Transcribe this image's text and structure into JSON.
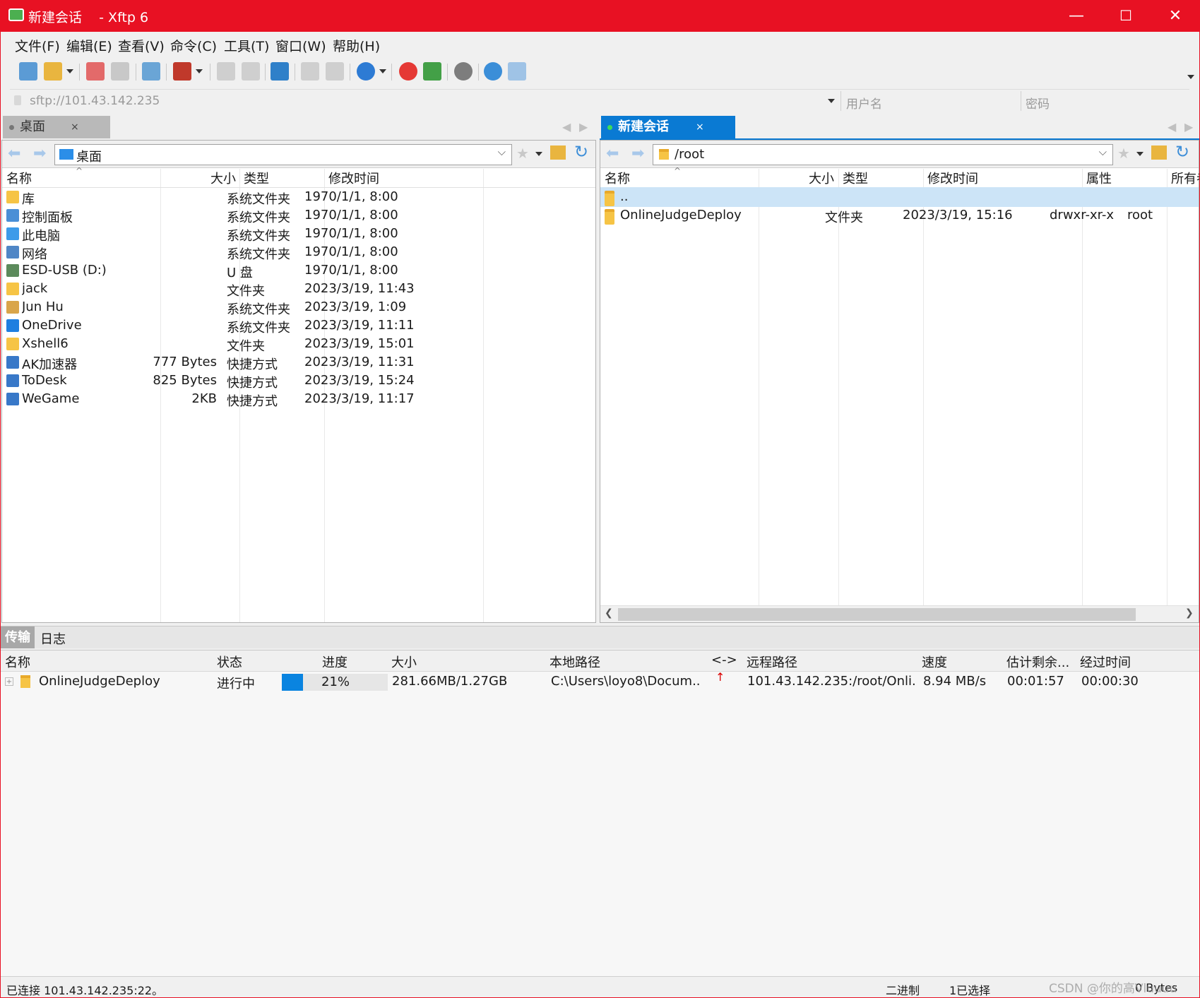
{
  "window": {
    "title": "新建会话    - Xftp 6",
    "controls": {
      "minimize": "—",
      "maximize": "☐",
      "close": "✕"
    }
  },
  "menu": [
    "文件(F)",
    "编辑(E)",
    "查看(V)",
    "命令(C)",
    "工具(T)",
    "窗口(W)",
    "帮助(H)"
  ],
  "address": {
    "url": "sftp://101.43.142.235",
    "username_placeholder": "用户名",
    "password_placeholder": "密码"
  },
  "local": {
    "tab_label": "桌面",
    "path": "桌面",
    "columns": [
      "名称",
      "大小",
      "类型",
      "修改时间"
    ],
    "rows": [
      {
        "name": "库",
        "size": "",
        "type": "系统文件夹",
        "modified": "1970/1/1, 8:00",
        "icon": "library-icon"
      },
      {
        "name": "控制面板",
        "size": "",
        "type": "系统文件夹",
        "modified": "1970/1/1, 8:00",
        "icon": "control-panel-icon"
      },
      {
        "name": "此电脑",
        "size": "",
        "type": "系统文件夹",
        "modified": "1970/1/1, 8:00",
        "icon": "computer-icon"
      },
      {
        "name": "网络",
        "size": "",
        "type": "系统文件夹",
        "modified": "1970/1/1, 8:00",
        "icon": "network-icon"
      },
      {
        "name": "ESD-USB (D:)",
        "size": "",
        "type": "U 盘",
        "modified": "1970/1/1, 8:00",
        "icon": "usb-drive-icon"
      },
      {
        "name": "jack",
        "size": "",
        "type": "文件夹",
        "modified": "2023/3/19, 11:43",
        "icon": "folder-icon"
      },
      {
        "name": "Jun Hu",
        "size": "",
        "type": "系统文件夹",
        "modified": "2023/3/19, 1:09",
        "icon": "user-folder-icon"
      },
      {
        "name": "OneDrive",
        "size": "",
        "type": "系统文件夹",
        "modified": "2023/3/19, 11:11",
        "icon": "cloud-icon"
      },
      {
        "name": "Xshell6",
        "size": "",
        "type": "文件夹",
        "modified": "2023/3/19, 15:01",
        "icon": "folder-icon"
      },
      {
        "name": "AK加速器",
        "size": "777 Bytes",
        "type": "快捷方式",
        "modified": "2023/3/19, 11:31",
        "icon": "shortcut-icon"
      },
      {
        "name": "ToDesk",
        "size": "825 Bytes",
        "type": "快捷方式",
        "modified": "2023/3/19, 15:24",
        "icon": "shortcut-icon"
      },
      {
        "name": "WeGame",
        "size": "2KB",
        "type": "快捷方式",
        "modified": "2023/3/19, 11:17",
        "icon": "shortcut-icon"
      }
    ]
  },
  "remote": {
    "tab_label": "新建会话",
    "path": "/root",
    "columns": [
      "名称",
      "大小",
      "类型",
      "修改时间",
      "属性",
      "所有者"
    ],
    "rows": [
      {
        "name": "..",
        "size": "",
        "type": "",
        "modified": "",
        "attr": "",
        "owner": ""
      },
      {
        "name": "OnlineJudgeDeploy",
        "size": "",
        "type": "文件夹",
        "modified": "2023/3/19, 15:16",
        "attr": "drwxr-xr-x",
        "owner": "root"
      }
    ]
  },
  "transfer": {
    "tabs": [
      "传输",
      "日志"
    ],
    "columns": [
      "名称",
      "状态",
      "进度",
      "大小",
      "本地路径",
      "<->",
      "远程路径",
      "速度",
      "估计剩余...",
      "经过时间"
    ],
    "rows": [
      {
        "name": "OnlineJudgeDeploy",
        "status": "进行中",
        "progress_label": "21%",
        "progress": 0.21,
        "size": "281.66MB/1.27GB",
        "local_path": "C:\\Users\\loyo8\\Docum...",
        "remote_path": "101.43.142.235:/root/Onli...",
        "speed": "8.94 MB/s",
        "eta": "00:01:57",
        "elapsed": "00:00:30"
      }
    ]
  },
  "status": {
    "connection": "已连接 101.43.142.235:22。",
    "mode": "二进制",
    "selected": "1已选择",
    "bytes": "0 Bytes",
    "watermark": "CSDN @你的高Vluuuu"
  },
  "colors": {
    "titlebar": "#e81123",
    "remote_accent": "#0a7ad3",
    "selection": "#cce4f7",
    "progress": "#0a84e0"
  }
}
